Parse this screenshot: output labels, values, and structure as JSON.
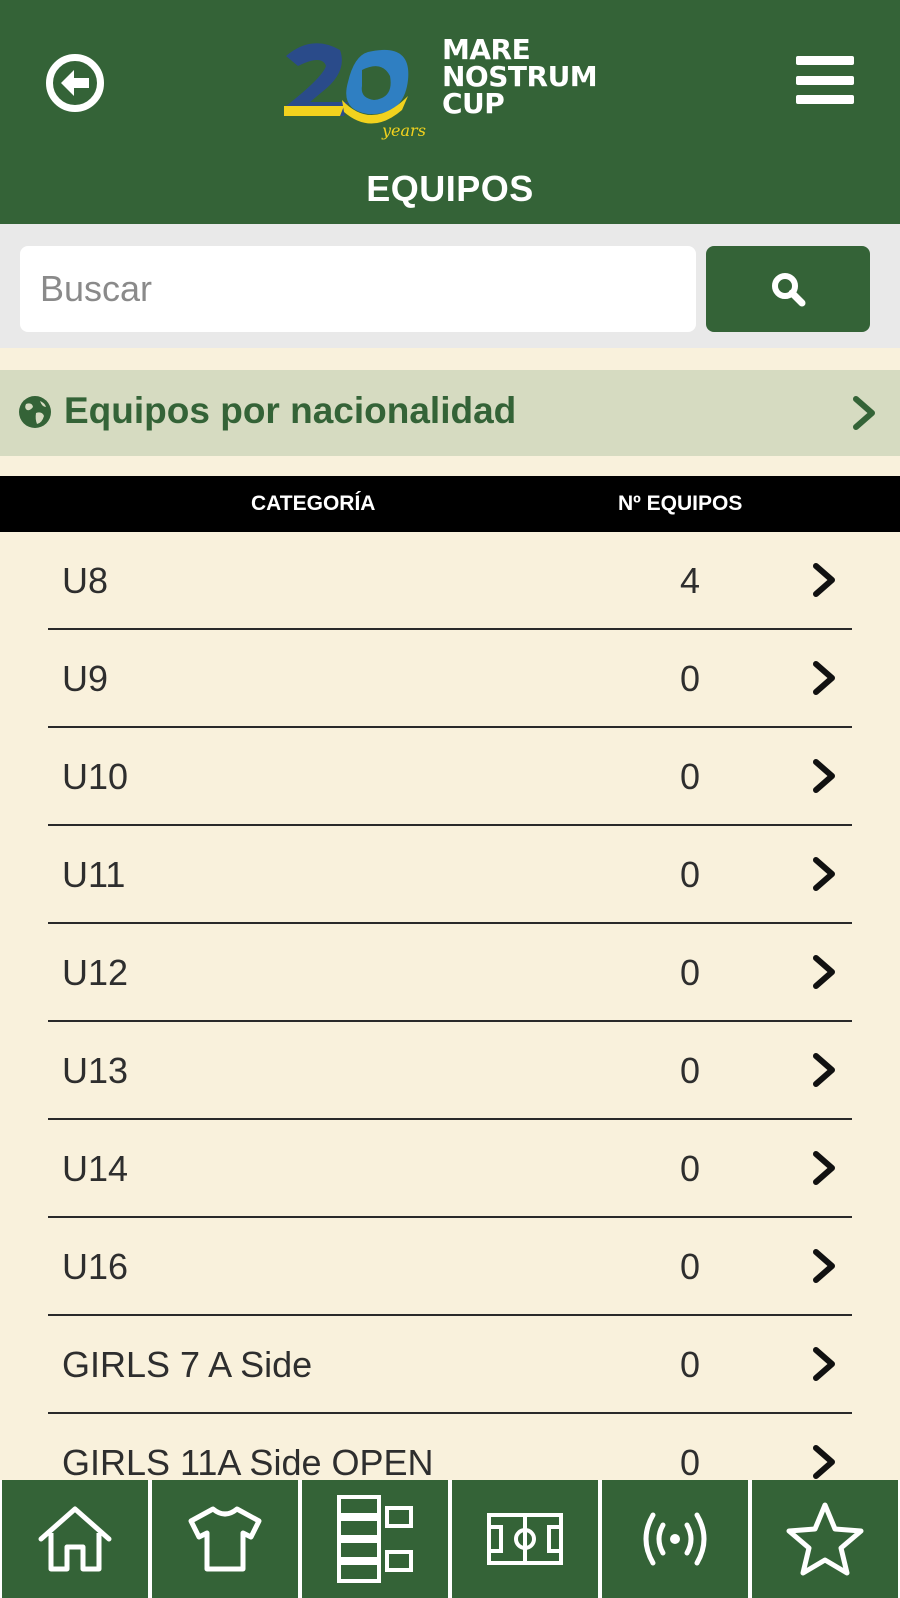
{
  "header": {
    "title": "EQUIPOS",
    "logo": {
      "number": "20",
      "sub": "years",
      "line1": "MARE",
      "line2": "NOSTRUM",
      "line3": "CUP"
    },
    "back_icon": "arrow-left-circle-icon",
    "menu_icon": "hamburger-menu-icon"
  },
  "search": {
    "placeholder": "Buscar",
    "value": "",
    "button_icon": "search-icon"
  },
  "nationality": {
    "label": "Equipos por nacionalidad",
    "icon": "globe-icon"
  },
  "table": {
    "headers": {
      "category": "CATEGORÍA",
      "count": "Nº EQUIPOS"
    },
    "rows": [
      {
        "name": "U8",
        "count": "4"
      },
      {
        "name": "U9",
        "count": "0"
      },
      {
        "name": "U10",
        "count": "0"
      },
      {
        "name": "U11",
        "count": "0"
      },
      {
        "name": "U12",
        "count": "0"
      },
      {
        "name": "U13",
        "count": "0"
      },
      {
        "name": "U14",
        "count": "0"
      },
      {
        "name": "U16",
        "count": "0"
      },
      {
        "name": "GIRLS 7 A Side",
        "count": "0"
      },
      {
        "name": "GIRLS 11A Side OPEN",
        "count": "0"
      }
    ]
  },
  "bottom_nav": [
    {
      "icon": "home-icon"
    },
    {
      "icon": "shirt-icon"
    },
    {
      "icon": "bracket-icon"
    },
    {
      "icon": "football-field-icon"
    },
    {
      "icon": "live-broadcast-icon"
    },
    {
      "icon": "star-icon"
    }
  ],
  "colors": {
    "primary": "#346337",
    "background": "#f9f1dc",
    "nationality_bg": "#d6dbc1",
    "table_header": "#000000"
  }
}
